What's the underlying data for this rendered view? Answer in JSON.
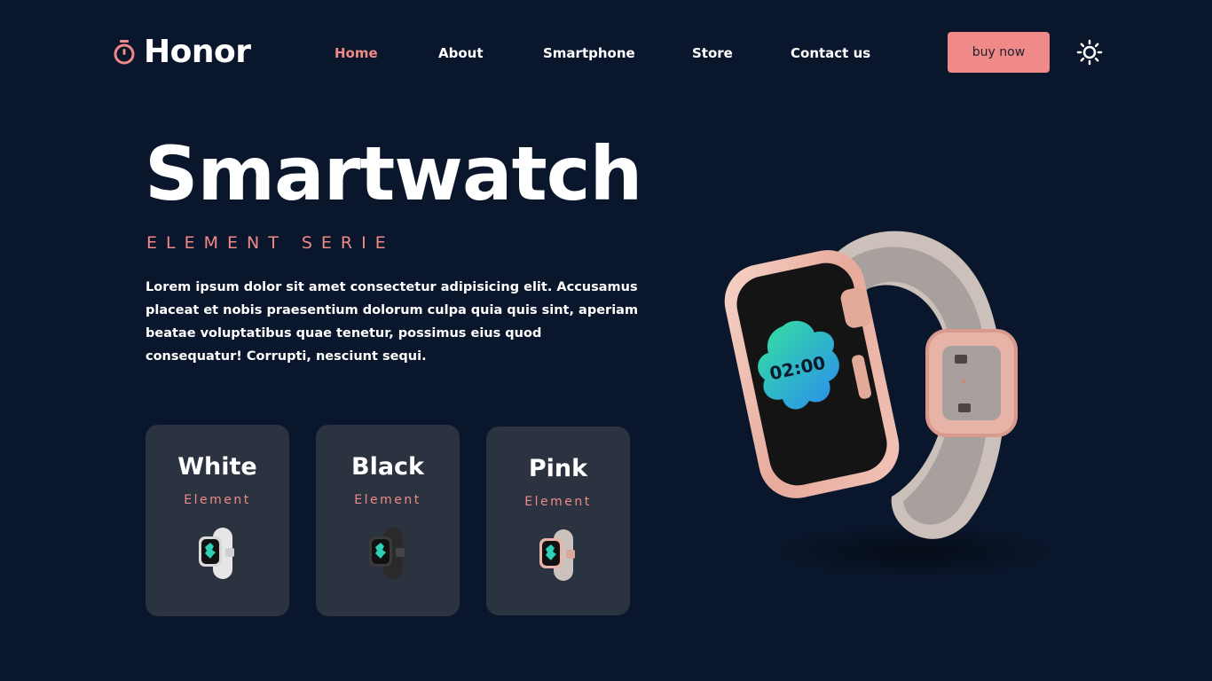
{
  "brand": {
    "name": "Honor"
  },
  "nav": {
    "items": [
      {
        "label": "Home",
        "active": true
      },
      {
        "label": "About",
        "active": false
      },
      {
        "label": "Smartphone",
        "active": false
      },
      {
        "label": "Store",
        "active": false
      },
      {
        "label": "Contact us",
        "active": false
      }
    ]
  },
  "header": {
    "buy_label": "buy now",
    "theme_icon": "sun-icon"
  },
  "hero": {
    "title": "Smartwatch",
    "subtitle": "ELEMENT SERIE",
    "description": "Lorem ipsum dolor sit amet consectetur adipisicing elit. Accusamus placeat et nobis praesentium dolorum culpa quia quis sint, aperiam beatae voluptatibus quae tenetur, possimus eius quod consequatur! Corrupti, nesciunt sequi.",
    "watch_time": "02:00"
  },
  "cards": [
    {
      "title": "White",
      "subtitle": "Element",
      "strap_color": "#e6e6e6",
      "case_color": "#d8d8d8"
    },
    {
      "title": "Black",
      "subtitle": "Element",
      "strap_color": "#2a2a2a",
      "case_color": "#3a3a3a"
    },
    {
      "title": "Pink",
      "subtitle": "Element",
      "strap_color": "#cbc2bd",
      "case_color": "#e8b4a8"
    }
  ],
  "colors": {
    "background": "#0a162b",
    "accent": "#ef8a88",
    "card": "#2b3240"
  }
}
